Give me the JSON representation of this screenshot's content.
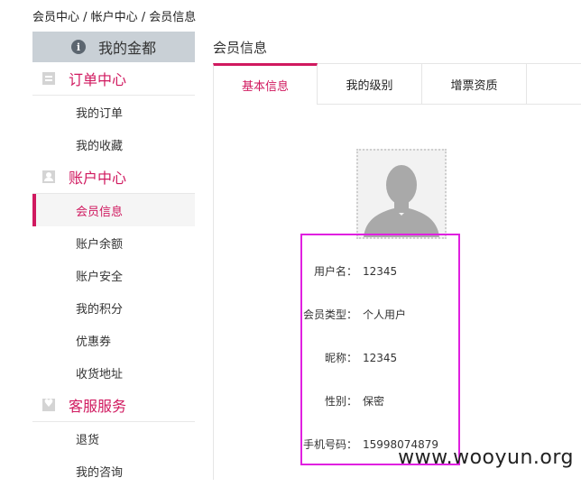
{
  "breadcrumb": "会员中心 / 帐户中心 / 会员信息",
  "sidebar": {
    "header": "我的金都",
    "sections": [
      {
        "title": "订单中心",
        "items": [
          "我的订单",
          "我的收藏"
        ]
      },
      {
        "title": "账户中心",
        "items": [
          "会员信息",
          "账户余额",
          "账户安全",
          "我的积分",
          "优惠券",
          "收货地址"
        ]
      },
      {
        "title": "客服服务",
        "items": [
          "退货",
          "我的咨询"
        ]
      }
    ],
    "active_item": "会员信息"
  },
  "main": {
    "title": "会员信息",
    "tabs": [
      "基本信息",
      "我的级别",
      "增票资质"
    ],
    "active_tab": "基本信息"
  },
  "profile": {
    "rows": [
      {
        "label": "用户名：",
        "value": "12345"
      },
      {
        "label": "会员类型：",
        "value": "个人用户"
      },
      {
        "label": "昵称：",
        "value": "12345"
      },
      {
        "label": "性别：",
        "value": "保密"
      },
      {
        "label": "手机号码：",
        "value": "15998074879"
      }
    ]
  },
  "watermark": "www.wooyun.org",
  "colors": {
    "accent": "#d0195f",
    "highlight": "#e020e0",
    "sidebar_header_bg": "#c9d0d6"
  }
}
